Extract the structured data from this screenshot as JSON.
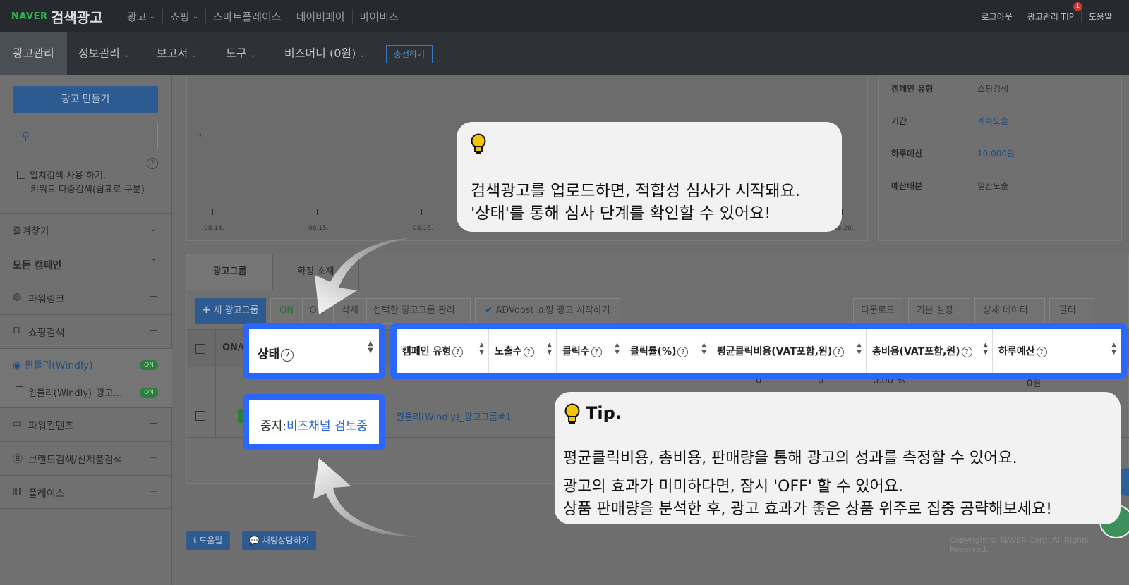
{
  "topbar": {
    "logo_naver": "NAVER",
    "logo_title": "검색광고",
    "nav": [
      "광고",
      "쇼핑",
      "스마트플레이스",
      "네이버페이",
      "마이비즈"
    ],
    "right": [
      "로그아웃",
      "광고관리 TIP",
      "도움말"
    ],
    "tip_badge": "1"
  },
  "menubar": {
    "items": [
      "광고관리",
      "정보관리",
      "보고서",
      "도구",
      "비즈머니 (0원)"
    ],
    "charge": "충전하기"
  },
  "sidebar": {
    "create_button": "광고 만들기",
    "search_placeholder": "",
    "exact_match_line1": "일치검색 사용 하기,",
    "exact_match_line2": "키워드 다중검색(쉼표로 구분)",
    "favorites": "즐겨찾기",
    "all_campaigns": "모든 캠페인",
    "items": [
      {
        "label": "파워링크",
        "icon": "globe-icon"
      },
      {
        "label": "쇼핑검색",
        "icon": "bag-icon"
      },
      {
        "label": "파워컨텐츠",
        "icon": "chat-icon"
      },
      {
        "label": "브랜드검색/신제품검색",
        "icon": "b-icon"
      },
      {
        "label": "플레이스",
        "icon": "map-icon"
      }
    ],
    "campaign": "윈들리(Windly)",
    "adgroup": "윈들리(Windly)_광고…",
    "on_label": "ON"
  },
  "chart": {
    "zero_label": "0",
    "x_ticks": [
      "08.14.",
      "08.15.",
      "08.16.",
      "08.20."
    ]
  },
  "info": {
    "rows": [
      {
        "k": "캠페인 유형",
        "v": "쇼핑검색"
      },
      {
        "k": "기간",
        "v": "계속노출"
      },
      {
        "k": "하루예산",
        "v": "10,000원"
      },
      {
        "k": "예산배분",
        "v": "일반노출"
      }
    ]
  },
  "table": {
    "tabs": [
      "광고그룹",
      "확장 소재"
    ],
    "toolbar": {
      "new_group": "✚ 새 광고그룹",
      "on": "ON",
      "off": "OFF",
      "delete": "삭제",
      "manage_selected": "선택한 광고그룹 관리",
      "advoost": "ADVoost 쇼핑 광고 시작하기",
      "download": "다운로드",
      "default_settings": "기본 설정",
      "detail_data": "상세 데이터",
      "filter": "필터"
    },
    "head_onoff": "ON/O",
    "head_status": "상태",
    "columns": [
      "캠페인 유형",
      "노출수",
      "클릭수",
      "클릭률(%)",
      "평균클릭비용(VAT포함,원)",
      "총비용(VAT포함,원)",
      "하루예산"
    ],
    "summary": {
      "impr": "0",
      "clicks": "0",
      "ctr": "0.00 %",
      "budget": "0원"
    },
    "row": {
      "status_prefix": "중지:",
      "status_link": "비즈채널 검토중",
      "group_name": "윈들리(Windly)_광고그룹#1"
    }
  },
  "footer": {
    "help": "도움말",
    "chat": "채팅상담하기",
    "copyright": "Copyright © NAVER Corp. All Rights Reserved."
  },
  "callout1": {
    "line1": "검색광고를 업로드하면, 적합성 심사가 시작돼요.",
    "line2": "'상태'를 통해 심사 단계를 확인할 수 있어요!"
  },
  "callout2": {
    "title": "Tip.",
    "line1": "평균클릭비용, 총비용, 판매량을 통해 광고의 성과를 측정할 수 있어요.",
    "line2": "광고의 효과가 미미하다면, 잠시 'OFF' 할 수 있어요.",
    "line3": "상품 판매량을 분석한 후, 광고 효과가 좋은 상품 위주로 집중 공략해보세요!"
  },
  "colors": {
    "highlight": "#2a67ff",
    "link": "#2a67d9",
    "bulb": "#f5c400"
  }
}
